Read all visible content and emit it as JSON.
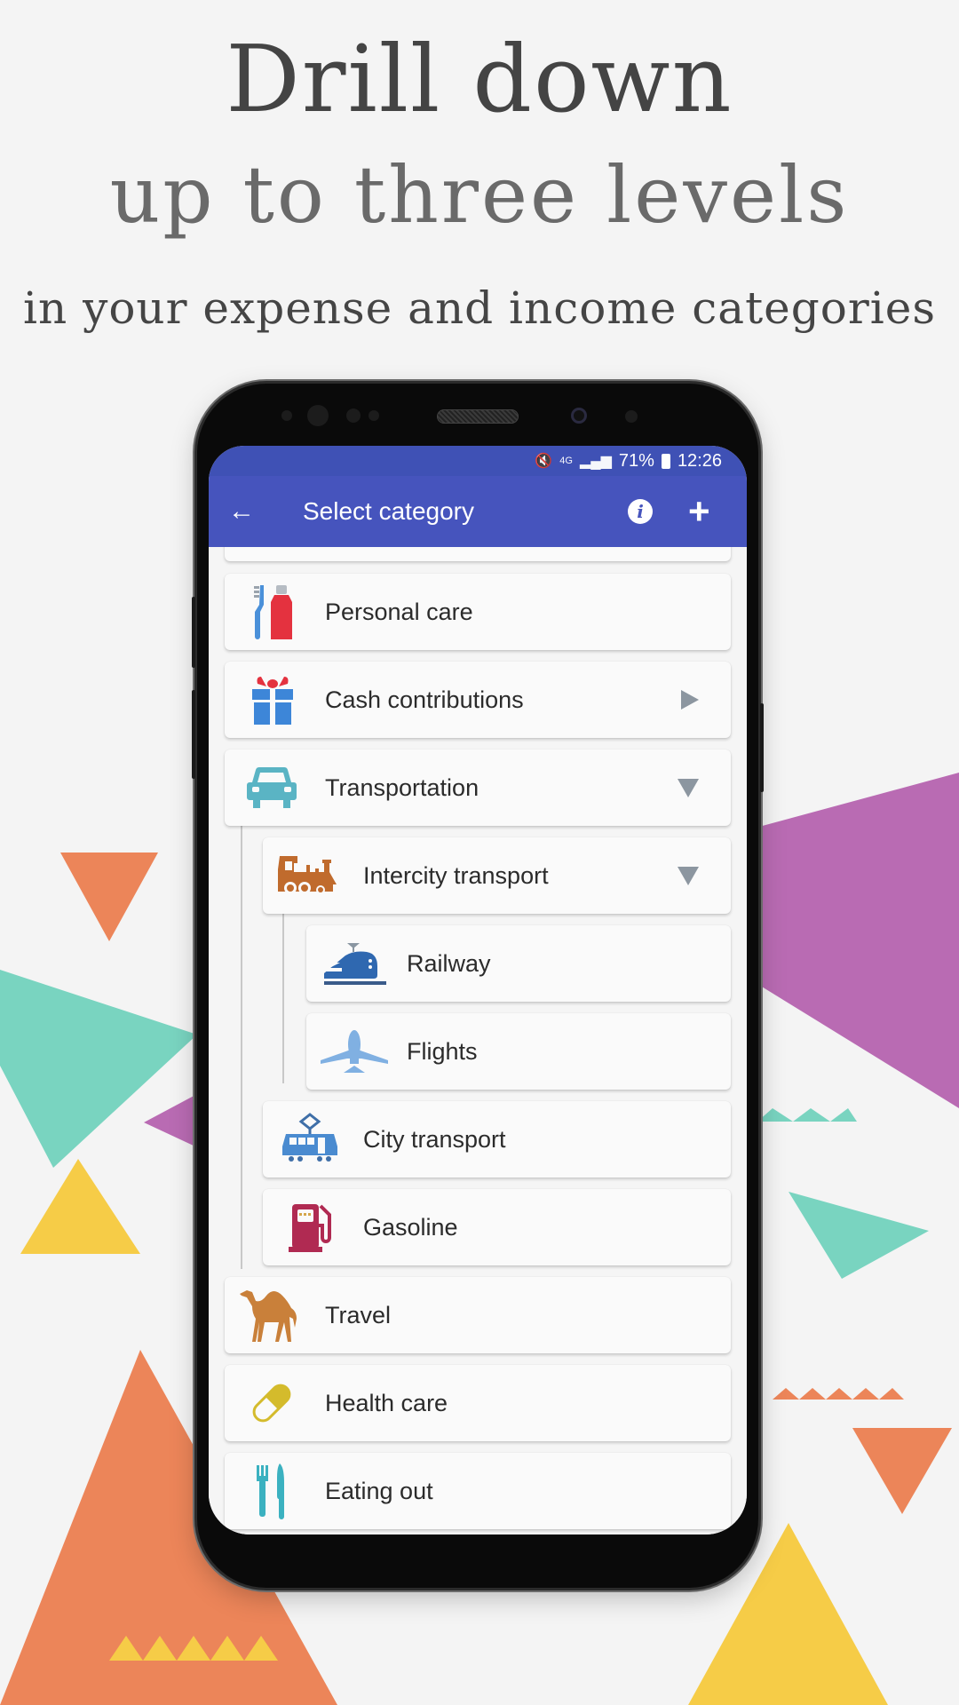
{
  "promo": {
    "headline_line1": "Drill down",
    "headline_line2": "up to three levels",
    "subheadline": "in your expense and income categories"
  },
  "status_bar": {
    "mute_icon": "mute-icon",
    "network": "4G",
    "signal_icon": "signal-icon",
    "battery": "71%",
    "battery_icon": "battery-icon",
    "time": "12:26"
  },
  "app_bar": {
    "back_icon": "←",
    "title": "Select category",
    "info_icon": "i",
    "add_icon": "+"
  },
  "colors": {
    "app_bar": "#4654bd",
    "status_bar": "#3f51b5",
    "expand_arrow": "#8c96a0",
    "bg_orange": "#ec8559",
    "bg_teal": "#79d4c0",
    "bg_purple": "#b96bb3",
    "bg_yellow": "#f6cc47"
  },
  "categories": [
    {
      "label": "Personal care",
      "icon": "toothbrush-toothpaste-icon",
      "level": 1,
      "expand": "none"
    },
    {
      "label": "Cash contributions",
      "icon": "gift-icon",
      "level": 1,
      "expand": "collapsed"
    },
    {
      "label": "Transportation",
      "icon": "car-icon",
      "level": 1,
      "expand": "expanded"
    },
    {
      "label": "Intercity transport",
      "icon": "steam-train-icon",
      "level": 2,
      "expand": "expanded"
    },
    {
      "label": "Railway",
      "icon": "bullet-train-icon",
      "level": 3,
      "expand": "none"
    },
    {
      "label": "Flights",
      "icon": "airplane-icon",
      "level": 3,
      "expand": "none"
    },
    {
      "label": "City transport",
      "icon": "tram-icon",
      "level": 2,
      "expand": "none"
    },
    {
      "label": "Gasoline",
      "icon": "fuel-pump-icon",
      "level": 2,
      "expand": "none"
    },
    {
      "label": "Travel",
      "icon": "camel-icon",
      "level": 1,
      "expand": "none"
    },
    {
      "label": "Health care",
      "icon": "pill-icon",
      "level": 1,
      "expand": "none"
    },
    {
      "label": "Eating out",
      "icon": "fork-knife-icon",
      "level": 1,
      "expand": "none"
    }
  ]
}
